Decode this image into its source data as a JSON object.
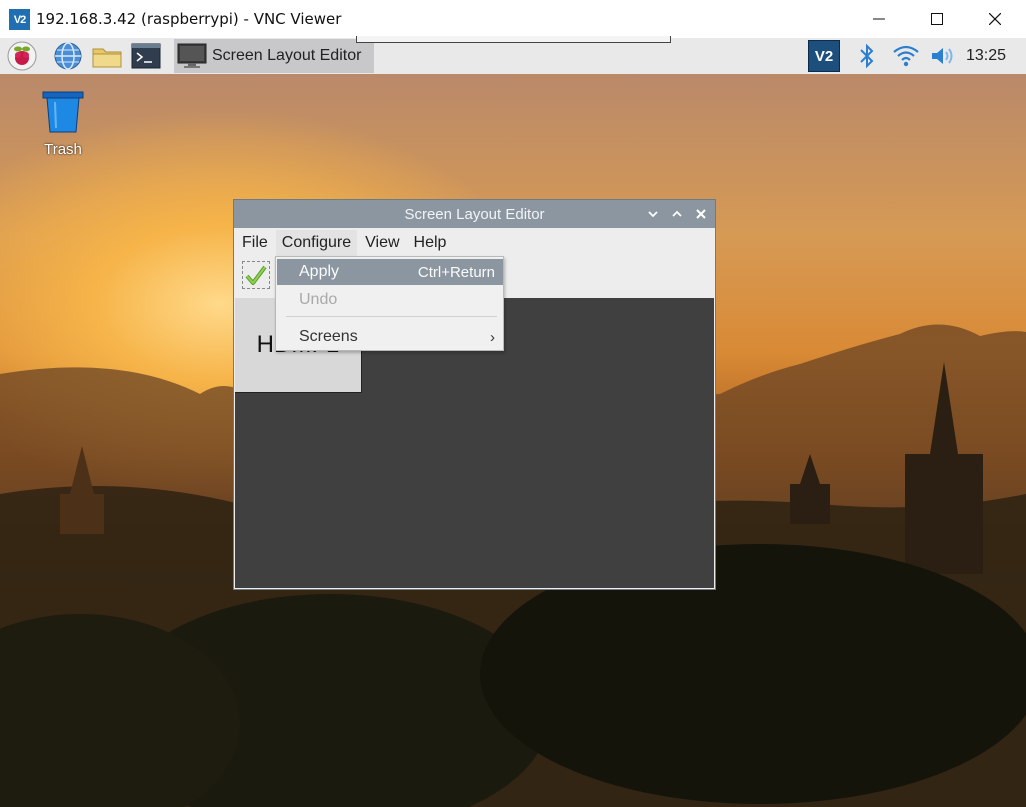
{
  "vnc_window": {
    "logo_text": "V2",
    "title": "192.168.3.42 (raspberrypi) - VNC Viewer"
  },
  "panel": {
    "task_button_label": "Screen Layout Editor",
    "clock": "13:25",
    "tray_vnc_text": "V2"
  },
  "desktop": {
    "trash_label": "Trash"
  },
  "editor_window": {
    "title": "Screen Layout Editor",
    "menus": [
      "File",
      "Configure",
      "View",
      "Help"
    ],
    "screen_label": "HDMI-1"
  },
  "configure_menu": {
    "apply_label": "Apply",
    "apply_shortcut": "Ctrl+Return",
    "undo_label": "Undo",
    "screens_label": "Screens",
    "screens_arrow": "›"
  },
  "colors": {
    "title_bar": "#8b96a0",
    "menu_highlight": "#8b96a0",
    "canvas": "#404040",
    "panel": "#e9e9ea"
  }
}
